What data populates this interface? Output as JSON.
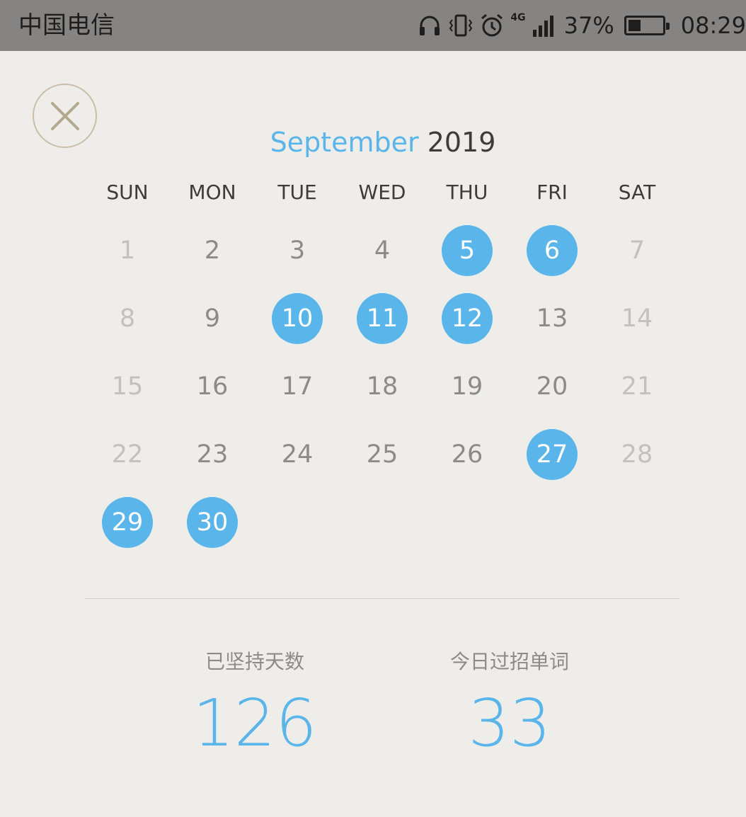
{
  "status_bar": {
    "carrier": "中国电信",
    "network": "4G",
    "battery_percent": "37%",
    "battery_level": 0.37,
    "time": "08:29",
    "icons": [
      "headphones-icon",
      "vibrate-icon",
      "alarm-icon",
      "signal-icon",
      "battery-icon"
    ]
  },
  "calendar": {
    "month": "September",
    "year": "2019",
    "weekdays": [
      "SUN",
      "MON",
      "TUE",
      "WED",
      "THU",
      "FRI",
      "SAT"
    ],
    "first_weekday_index": 0,
    "days_in_month": 30,
    "marked_days": [
      5,
      6,
      10,
      11,
      12,
      27,
      29,
      30
    ],
    "weekday_numbers": [
      "1",
      "2",
      "3",
      "4",
      "5",
      "6",
      "7",
      "8",
      "9",
      "10",
      "11",
      "12",
      "13",
      "14",
      "15",
      "16",
      "17",
      "18",
      "19",
      "20",
      "21",
      "22",
      "23",
      "24",
      "25",
      "26",
      "27",
      "28",
      "29",
      "30"
    ]
  },
  "stats": {
    "days_label": "已坚持天数",
    "days_value": "126",
    "words_label": "今日过招单词",
    "words_value": "33"
  },
  "colors": {
    "accent": "#5ab5ea",
    "background": "#efedea",
    "status_bar": "#858483",
    "close_ring": "#c9bfa9"
  }
}
